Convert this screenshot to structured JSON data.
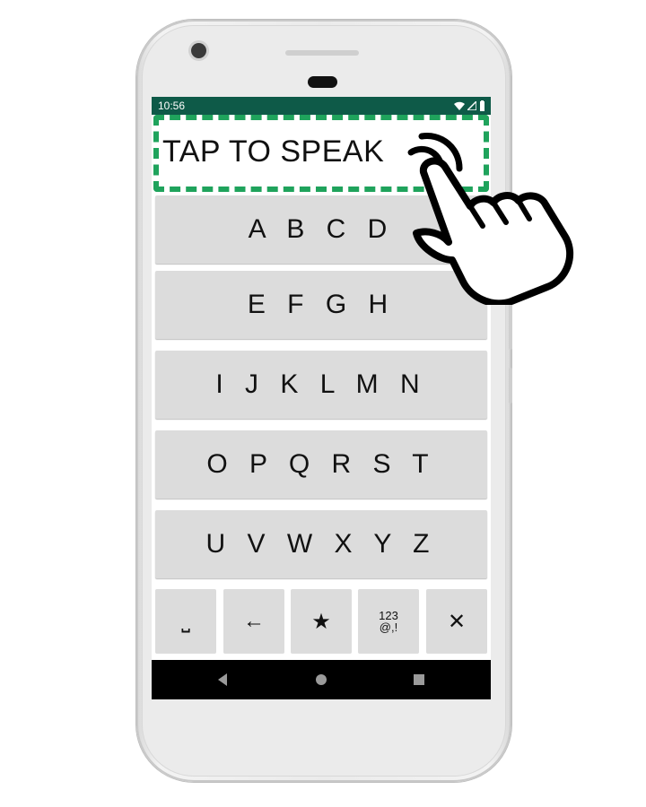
{
  "status_bar": {
    "time": "10:56"
  },
  "speak": {
    "label": "TAP TO SPEAK"
  },
  "letter_rows": [
    "A B C D",
    "E F G H",
    "I J K L M N",
    "O P Q R S T",
    "U V W X Y Z"
  ],
  "bottom_keys": {
    "space": "⎵",
    "backspace": "←",
    "favorites": "★",
    "numbers_line1": "123",
    "numbers_line2": "@,!",
    "clear": "✕"
  },
  "colors": {
    "status_bar": "#0e5a48",
    "highlight_dash": "#1fa35c",
    "key_bg": "#dcdcdc"
  },
  "icons": [
    "wifi-icon",
    "signal-icon",
    "battery-icon",
    "pointing-hand-icon",
    "nav-back-icon",
    "nav-home-icon",
    "nav-recents-icon"
  ]
}
